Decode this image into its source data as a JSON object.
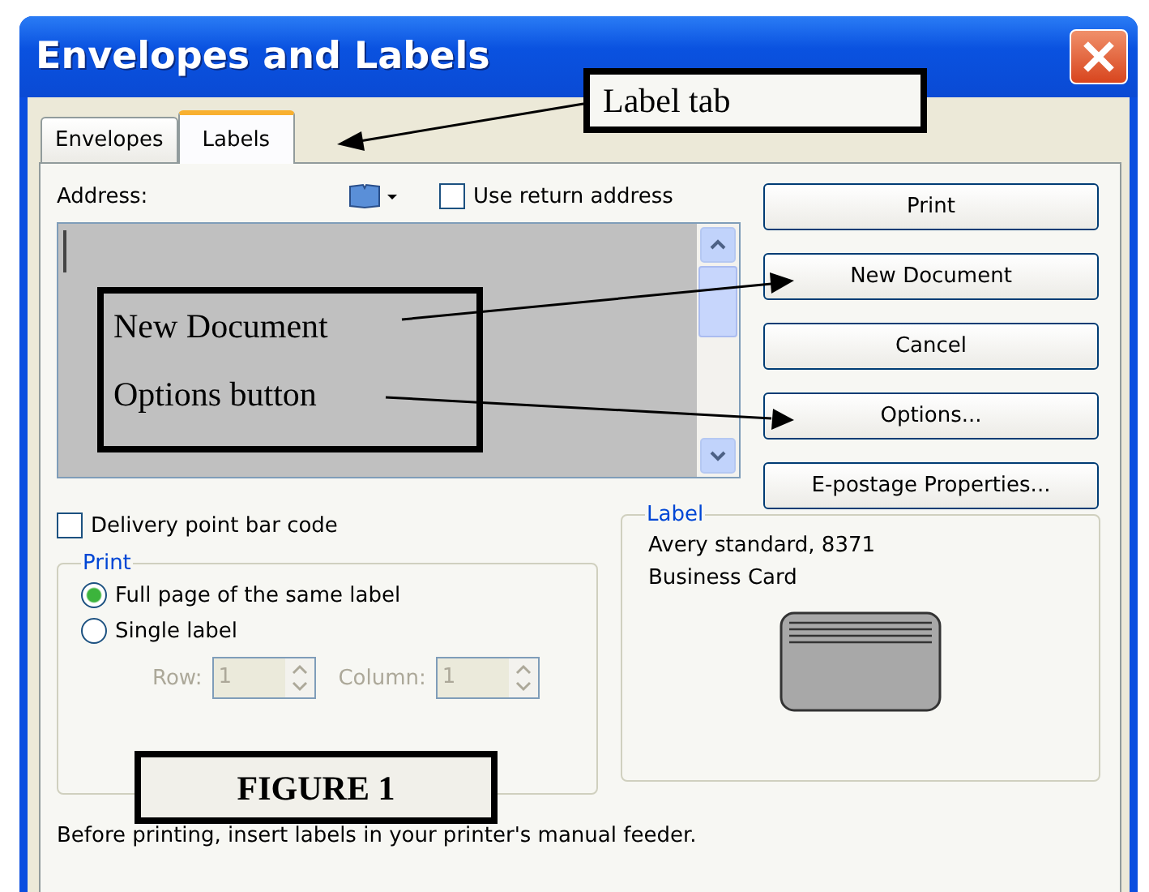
{
  "window": {
    "title": "Envelopes and Labels"
  },
  "tabs": [
    {
      "label": "Envelopes",
      "selected": false
    },
    {
      "label": "Labels",
      "selected": true
    }
  ],
  "address": {
    "label": "Address:",
    "use_return_address": {
      "label": "Use return address",
      "checked": false
    }
  },
  "buttons": [
    {
      "label": "Print"
    },
    {
      "label": "New Document"
    },
    {
      "label": "Cancel"
    },
    {
      "label": "Options..."
    },
    {
      "label": "E-postage Properties..."
    }
  ],
  "delivery_point_bar_code": {
    "label": "Delivery point bar code",
    "checked": false
  },
  "print_group": {
    "title": "Print",
    "options": [
      {
        "label": "Full page of the same label",
        "selected": true
      },
      {
        "label": "Single label",
        "selected": false
      }
    ],
    "row": {
      "label": "Row:",
      "value": "1",
      "disabled": true
    },
    "column": {
      "label": "Column:",
      "value": "1",
      "disabled": true
    }
  },
  "label_group": {
    "title": "Label",
    "lines": [
      "Avery standard, 8371",
      "Business Card"
    ]
  },
  "footer_note": "Before printing, insert labels in your printer's manual feeder.",
  "annotations": [
    {
      "lines": [
        "Label tab"
      ]
    },
    {
      "lines": [
        "New Document",
        "Options button"
      ]
    },
    {
      "lines": [
        "FIGURE 1"
      ]
    }
  ]
}
